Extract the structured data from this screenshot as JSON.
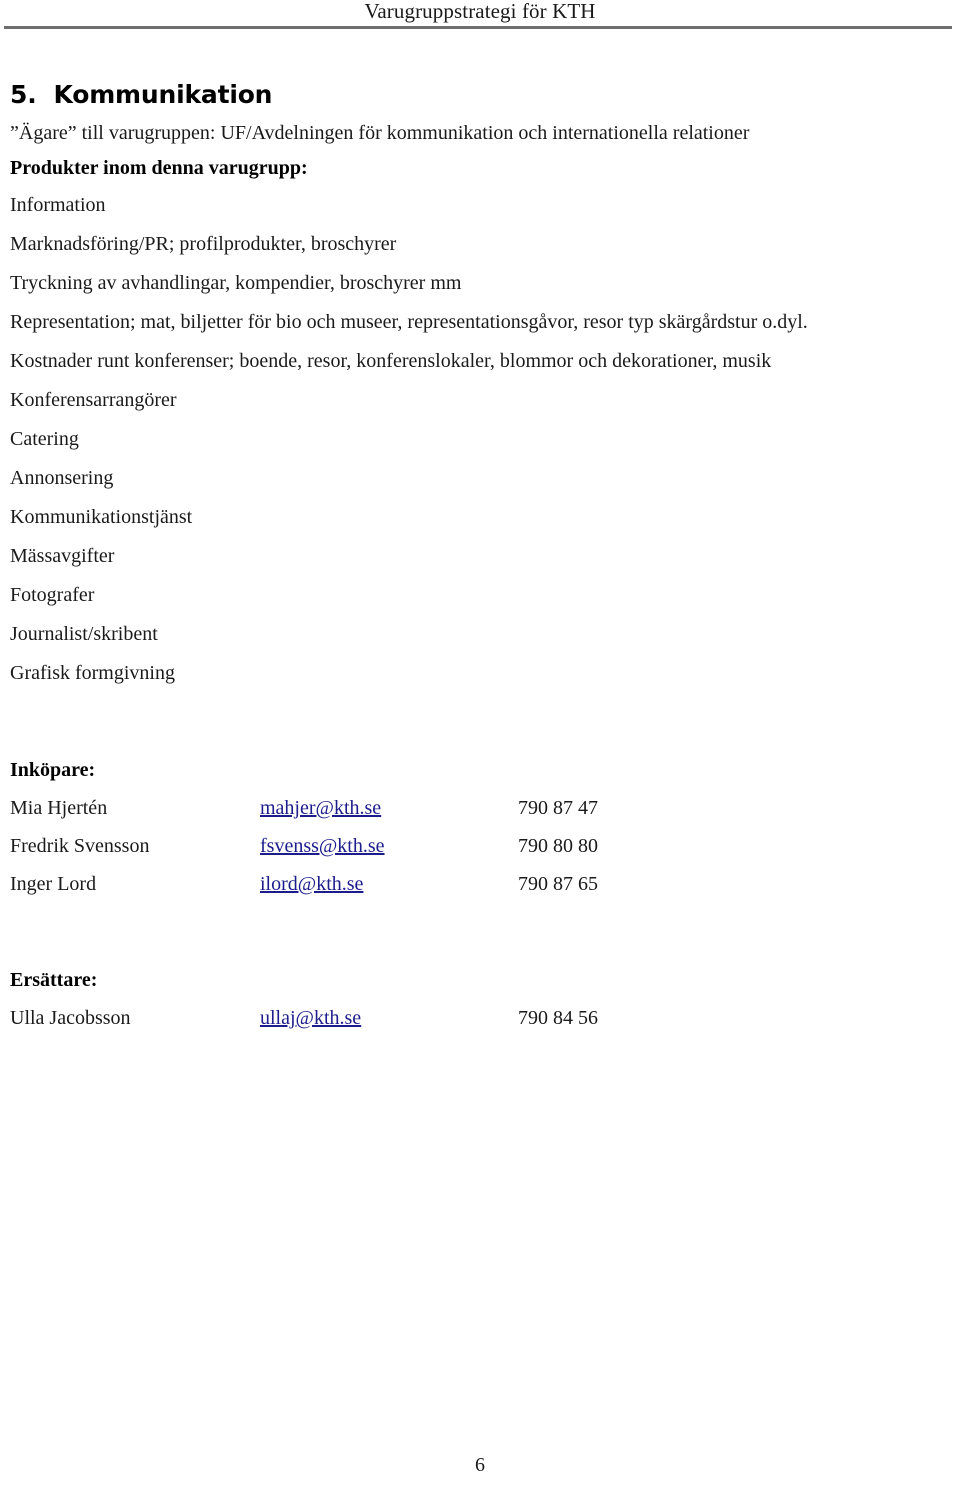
{
  "document": {
    "running_header": "Varugruppstrategi för KTH",
    "page_number": "6"
  },
  "section": {
    "heading": "5.  Kommunikation",
    "owner_line": "”Ägare” till varugruppen: UF/Avdelningen för kommunikation och internationella relationer",
    "products_heading": "Produkter inom denna varugrupp:",
    "products": [
      "Information",
      "Marknadsföring/PR; profilprodukter, broschyrer",
      "Tryckning av avhandlingar, kompendier, broschyrer mm",
      "Representation; mat, biljetter för bio och museer, representationsgåvor, resor typ skärgårdstur o.dyl.",
      "Kostnader runt konferenser; boende, resor, konferenslokaler, blommor och dekorationer, musik",
      "Konferensarrangörer",
      "Catering",
      "Annonsering",
      "Kommunikationstjänst",
      "Mässavgifter",
      "Fotografer",
      "Journalist/skribent",
      "Grafisk formgivning"
    ]
  },
  "buyers": {
    "heading": "Inköpare:",
    "rows": [
      {
        "name": "Mia Hjertén",
        "email": "mahjer@kth.se",
        "phone": "790 87 47"
      },
      {
        "name": "Fredrik Svensson",
        "email": "fsvenss@kth.se",
        "phone": "790 80 80"
      },
      {
        "name": "Inger Lord",
        "email": "ilord@kth.se",
        "phone": "790 87 65"
      }
    ]
  },
  "substitutes": {
    "heading": "Ersättare:",
    "rows": [
      {
        "name": "Ulla Jacobsson",
        "email": "ullaj@kth.se",
        "phone": "790 84 56"
      }
    ]
  },
  "colors": {
    "text": "#1a1a1a",
    "link": "#1c1c8c",
    "rule": "#6e6e6e"
  }
}
